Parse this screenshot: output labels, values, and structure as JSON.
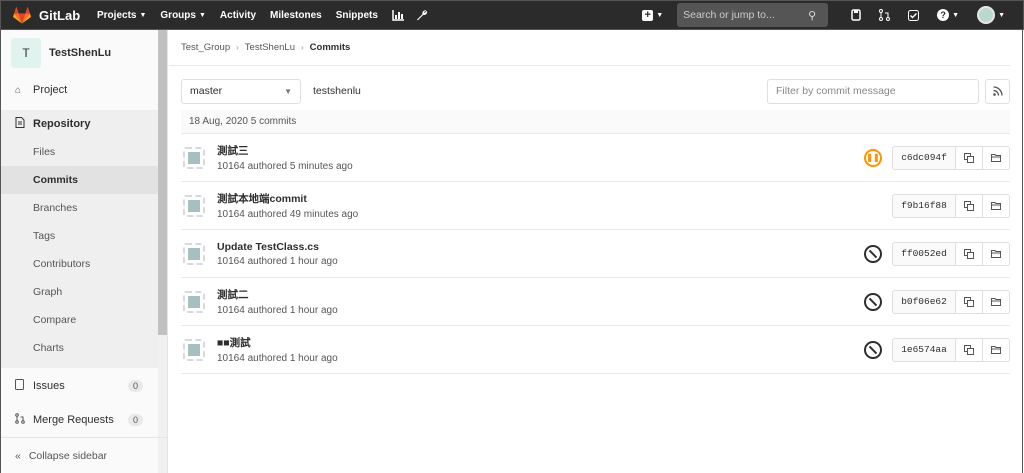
{
  "app": {
    "name": "GitLab"
  },
  "navbar": {
    "items": [
      {
        "label": "Projects",
        "dropdown": true
      },
      {
        "label": "Groups",
        "dropdown": true
      },
      {
        "label": "Activity",
        "dropdown": false
      },
      {
        "label": "Milestones",
        "dropdown": false
      },
      {
        "label": "Snippets",
        "dropdown": false
      }
    ],
    "search_placeholder": "Search or jump to...",
    "help_glyph": "?"
  },
  "sidebar": {
    "project_initial": "T",
    "project_name": "TestShenLu",
    "project_label": "Project",
    "repository_label": "Repository",
    "repository_items": [
      "Files",
      "Commits",
      "Branches",
      "Tags",
      "Contributors",
      "Graph",
      "Compare",
      "Charts"
    ],
    "active_item": "Commits",
    "issues_label": "Issues",
    "issues_count": "0",
    "merge_requests_label": "Merge Requests",
    "merge_requests_count": "0",
    "collapse_label": "Collapse sidebar"
  },
  "breadcrumb": [
    "Test_Group",
    "TestShenLu",
    "Commits"
  ],
  "filters": {
    "branch": "master",
    "path": "testshenlu",
    "filter_placeholder": "Filter by commit message"
  },
  "day_header": "18 Aug, 2020 5 commits",
  "commits": [
    {
      "title": "測試三",
      "meta": "10164 authored 5 minutes ago",
      "status": "paused",
      "sha": "c6dc094f"
    },
    {
      "title": "測試本地端commit",
      "meta": "10164 authored 49 minutes ago",
      "status": "none",
      "sha": "f9b16f88"
    },
    {
      "title": "Update TestClass.cs",
      "meta": "10164 authored 1 hour ago",
      "status": "skipped",
      "sha": "ff0052ed"
    },
    {
      "title": "測試二",
      "meta": "10164 authored 1 hour ago",
      "status": "skipped",
      "sha": "b0f06e62"
    },
    {
      "title": "■■測試",
      "meta": "10164 authored 1 hour ago",
      "status": "skipped",
      "sha": "1e6574aa"
    }
  ],
  "colors": {
    "navbar_bg": "#2b2b2b",
    "logo_orange": "#e24329",
    "status_paused": "#fc9403",
    "status_skipped": "#2e2e2e"
  }
}
